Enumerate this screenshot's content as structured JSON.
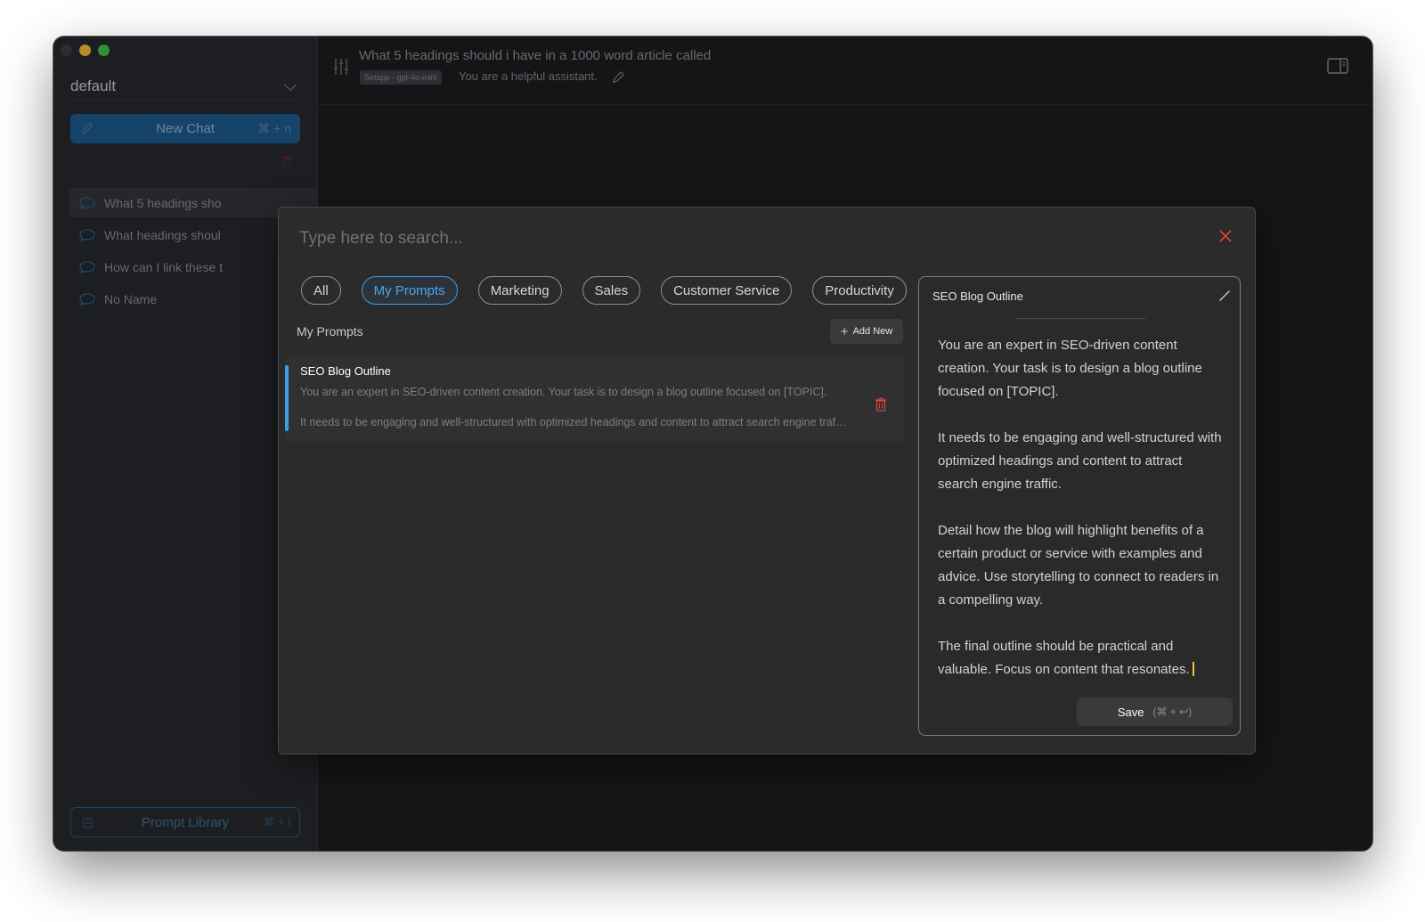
{
  "sidebar": {
    "workspace": "default",
    "new_chat": {
      "label": "New Chat",
      "shortcut": "⌘ + n"
    },
    "chats": [
      {
        "title": "What 5 headings sho",
        "active": true
      },
      {
        "title": "What headings shoul",
        "active": false
      },
      {
        "title": "How can I link these t",
        "active": false
      },
      {
        "title": "No Name",
        "active": false
      }
    ],
    "prompt_library": {
      "label": "Prompt Library",
      "shortcut": "⌘ + l"
    }
  },
  "header": {
    "title": "What 5 headings should i have in a 1000 word article called",
    "model_badge": "Setapp - gpt-4o-mini",
    "system_prompt": "You are a helpful assistant."
  },
  "modal": {
    "search_placeholder": "Type here to search...",
    "categories": [
      "All",
      "My Prompts",
      "Marketing",
      "Sales",
      "Customer Service",
      "Productivity"
    ],
    "active_category": "My Prompts",
    "section_label": "My Prompts",
    "add_new_label": "Add New",
    "prompts": [
      {
        "title": "SEO Blog Outline",
        "line1": "You are an expert in SEO-driven content creation. Your task is to design a blog outline focused on [TOPIC].",
        "line2": "It needs to be engaging and well-structured with optimized headings and content to attract search engine traf…"
      }
    ],
    "editor": {
      "title": "SEO Blog Outline",
      "body": "You are an expert in SEO-driven content creation. Your task is to design a blog outline focused on [TOPIC].\n\nIt needs to be engaging and well-structured with optimized headings and content to attract search engine traffic.\n\nDetail how the blog will highlight benefits of a certain product or service with examples and advice. Use storytelling to connect to readers in a compelling way.\n\nThe final outline should be practical and valuable. Focus on content that resonates.",
      "save_label": "Save",
      "save_shortcut": "(⌘ + ↩)"
    }
  },
  "colors": {
    "accent": "#3f9de0",
    "danger": "#e0443e",
    "caret": "#f4bd3c"
  },
  "icons": [
    "pencil-icon",
    "trash-icon",
    "chat-bubble-icon",
    "book-icon",
    "sliders-icon",
    "panel-toggle-icon",
    "close-icon",
    "plus-icon"
  ]
}
